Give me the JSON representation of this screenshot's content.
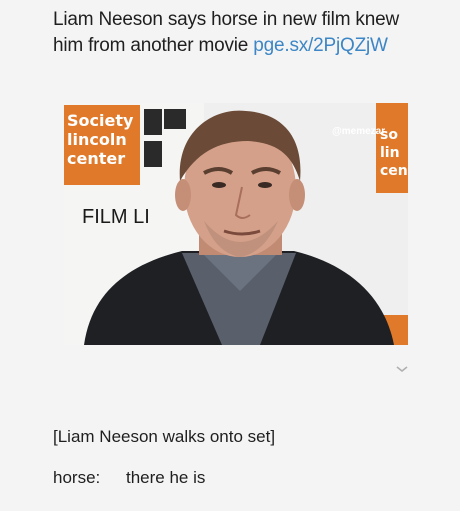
{
  "post": {
    "headline_text": "Liam Neeson says horse in new film knew him from another movie ",
    "headline_link": "pge.sx/2PjQZjW"
  },
  "photo": {
    "watermark": "@memezar",
    "backdrop_logo_lines": [
      "Society",
      "lincoln",
      "center"
    ],
    "backdrop_banner": "FILM LI"
  },
  "caption": {
    "stage_direction": "[Liam Neeson walks onto set]",
    "speaker": "horse:",
    "line": "there he is"
  },
  "colors": {
    "link": "#3d86c6",
    "logo_orange": "#e07a2a",
    "jacket": "#1f2024",
    "shirt": "#59606c"
  }
}
